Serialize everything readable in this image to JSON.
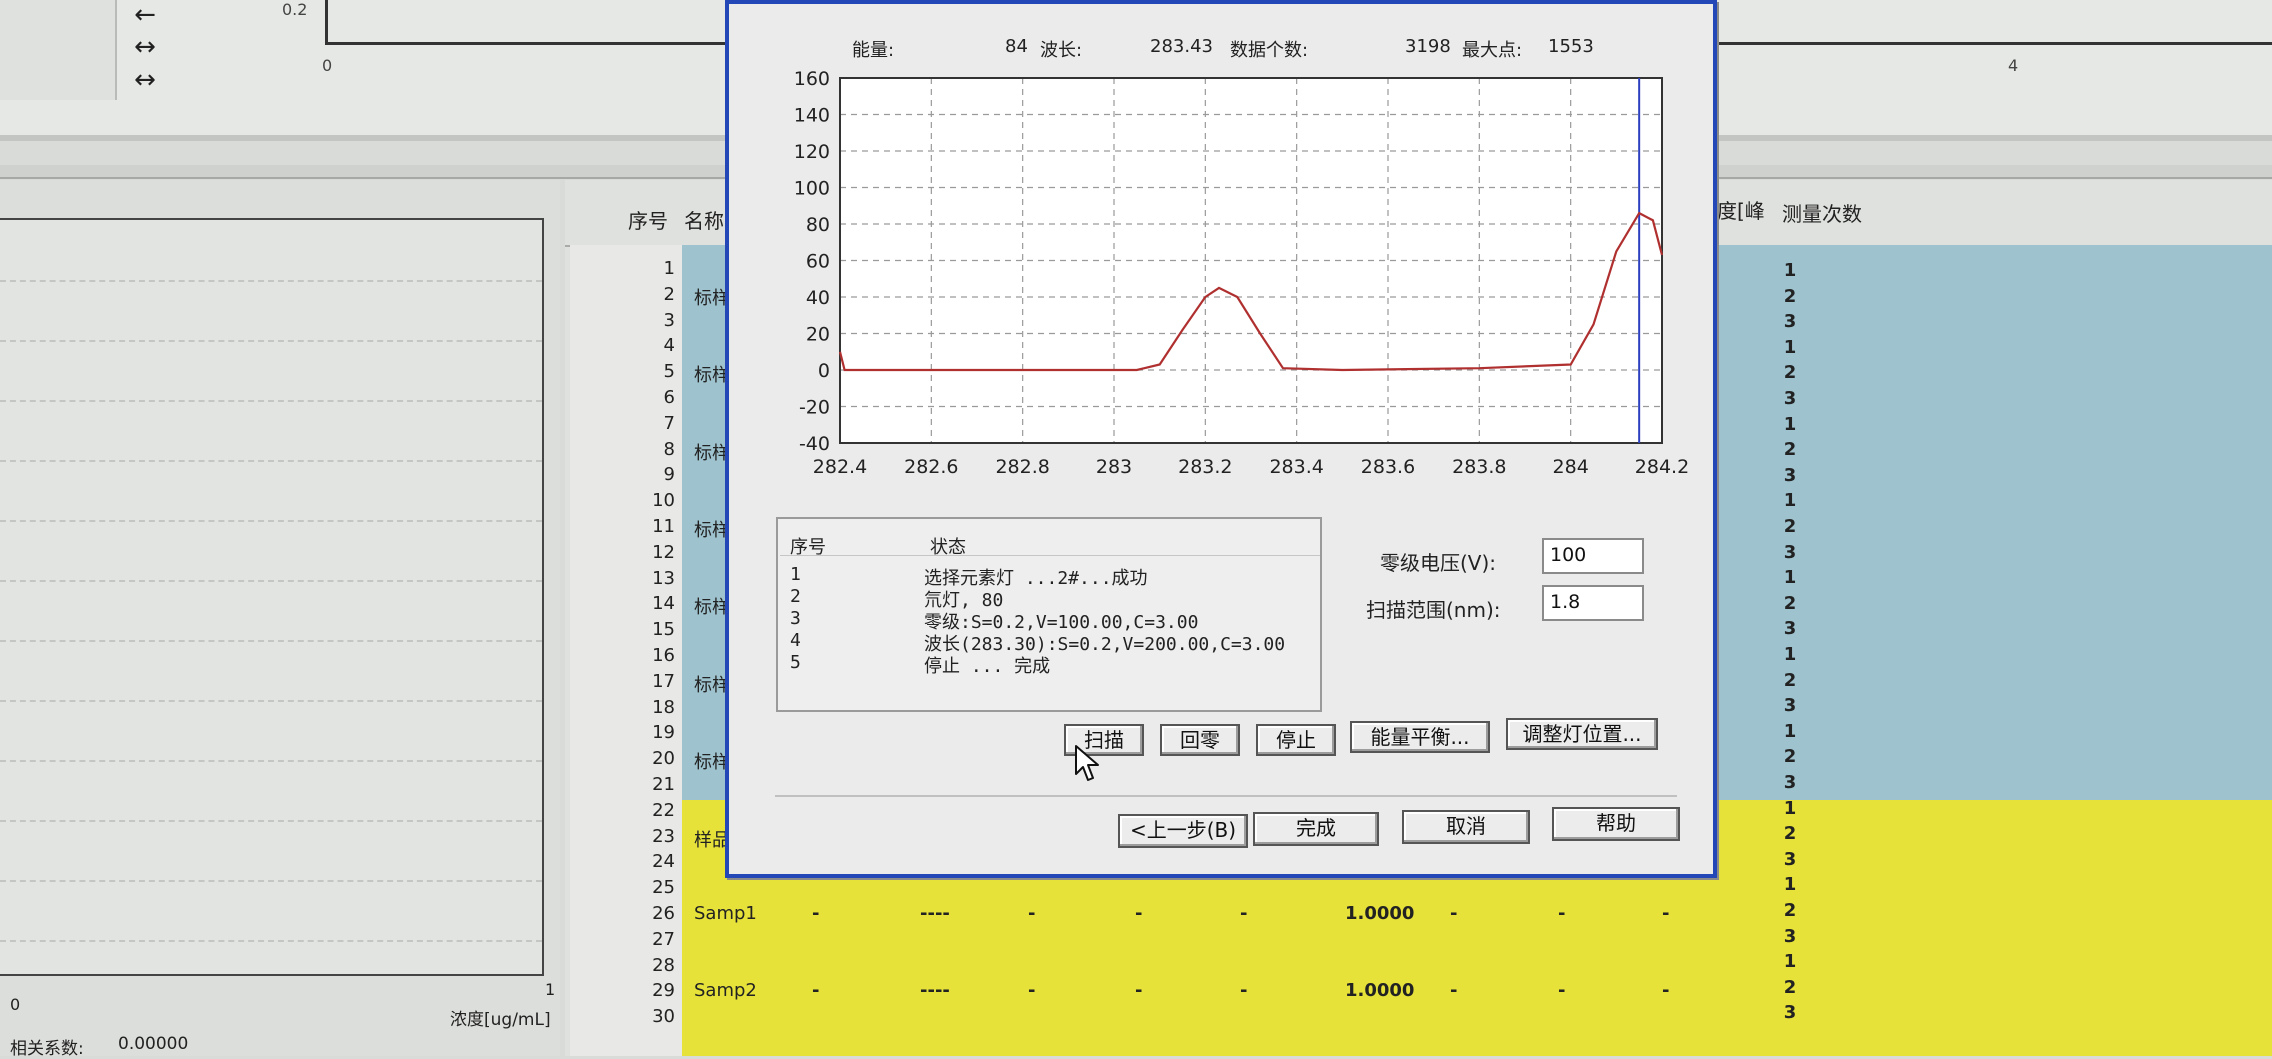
{
  "background": {
    "top_chart": {
      "ytick": "0.2",
      "xticks": [
        "0",
        "4"
      ]
    },
    "arrows": [
      "←",
      "↔",
      "↔"
    ],
    "calibration": {
      "x_start": "0",
      "x_end": "1",
      "xlabel": "浓度[ug/mL]",
      "coef_label": "相关系数:",
      "coef_value": "0.00000"
    },
    "table": {
      "headers": {
        "seq": "序号",
        "name": "名称",
        "right_partial": "度[峰",
        "count": "测量次数"
      },
      "row_numbers": [
        "1",
        "2",
        "3",
        "4",
        "5",
        "6",
        "7",
        "8",
        "9",
        "10",
        "11",
        "12",
        "13",
        "14",
        "15",
        "16",
        "17",
        "18",
        "19",
        "20",
        "21",
        "22",
        "23",
        "24",
        "25",
        "26",
        "27",
        "28",
        "29",
        "30"
      ],
      "names": [
        {
          "row": 2,
          "text": "标样"
        },
        {
          "row": 5,
          "text": "标样"
        },
        {
          "row": 8,
          "text": "标样"
        },
        {
          "row": 11,
          "text": "标样"
        },
        {
          "row": 14,
          "text": "标样"
        },
        {
          "row": 17,
          "text": "标样"
        },
        {
          "row": 20,
          "text": "标样"
        },
        {
          "row": 23,
          "text": "样品"
        },
        {
          "row": 26,
          "text": "Samp1"
        },
        {
          "row": 29,
          "text": "Samp2"
        }
      ],
      "measure_counts": [
        "1",
        "2",
        "3",
        "1",
        "2",
        "3",
        "1",
        "2",
        "3",
        "1",
        "2",
        "3",
        "1",
        "2",
        "3",
        "1",
        "2",
        "3",
        "1",
        "2",
        "3",
        "1",
        "2",
        "3",
        "1",
        "2",
        "3",
        "1",
        "2",
        "3"
      ],
      "sample_cells": {
        "dash": "-",
        "long_dash": "----",
        "weight": "1.0000"
      }
    }
  },
  "dialog": {
    "info": {
      "energy_label": "能量:",
      "energy_value": "84",
      "wavelength_label": "波长:",
      "wavelength_value": "283.43",
      "count_label": "数据个数:",
      "count_value": "3198",
      "max_label": "最大点:",
      "max_value": "1553"
    },
    "status_header": {
      "seq": "序号",
      "state": "状态"
    },
    "status_rows": [
      {
        "no": "1",
        "text": "选择元素灯 ...2#...成功"
      },
      {
        "no": "2",
        "text": "氘灯, 80"
      },
      {
        "no": "3",
        "text": "零级:S=0.2,V=100.00,C=3.00"
      },
      {
        "no": "4",
        "text": "波长(283.30):S=0.2,V=200.00,C=3.00"
      },
      {
        "no": "5",
        "text": "停止 ... 完成"
      }
    ],
    "fields": {
      "zero_voltage_label": "零级电压(V):",
      "zero_voltage_value": "100",
      "scan_range_label": "扫描范围(nm):",
      "scan_range_value": "1.8"
    },
    "buttons": {
      "scan": "扫描",
      "zero": "回零",
      "stop": "停止",
      "energy_balance": "能量平衡...",
      "adjust_lamp": "调整灯位置...",
      "prev": "<上一步(B)",
      "finish": "完成",
      "cancel": "取消",
      "help": "帮助"
    }
  },
  "chart_data": {
    "type": "line",
    "xlim": [
      282.4,
      284.2
    ],
    "ylim": [
      -40,
      160
    ],
    "xticks": [
      "282.4",
      "282.6",
      "282.8",
      "283",
      "283.2",
      "283.4",
      "283.6",
      "283.8",
      "284",
      "284.2"
    ],
    "yticks": [
      "160",
      "140",
      "120",
      "100",
      "80",
      "60",
      "40",
      "20",
      "0",
      "-20",
      "-40"
    ],
    "grid": true,
    "cursor_x": 284.15,
    "series": [
      {
        "color": "#b03030",
        "x": [
          282.4,
          282.41,
          283.05,
          283.1,
          283.15,
          283.2,
          283.23,
          283.27,
          283.32,
          283.37,
          283.5,
          283.8,
          284.0,
          284.05,
          284.1,
          284.15,
          284.18,
          284.2
        ],
        "y": [
          10,
          0,
          0,
          3,
          22,
          40,
          45,
          40,
          20,
          1,
          0,
          1,
          3,
          25,
          65,
          86,
          82,
          63
        ]
      }
    ]
  }
}
